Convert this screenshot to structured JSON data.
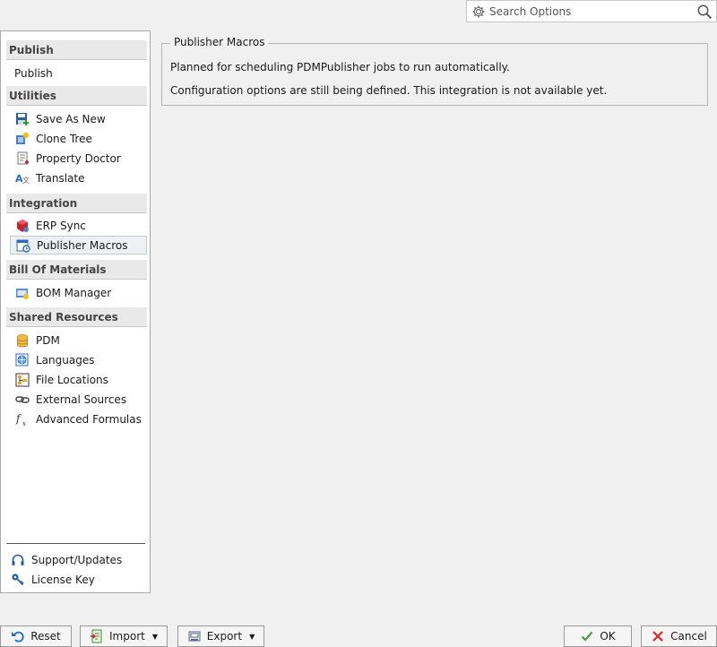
{
  "search": {
    "placeholder": "Search Options"
  },
  "sidebar": {
    "groups": [
      {
        "header": "Publish",
        "items": [
          {
            "label": "Publish",
            "icon": "none"
          }
        ]
      },
      {
        "header": "Utilities",
        "items": [
          {
            "label": "Save As New",
            "icon": "save-as-new-icon"
          },
          {
            "label": "Clone Tree",
            "icon": "clone-tree-icon"
          },
          {
            "label": "Property Doctor",
            "icon": "property-doctor-icon"
          },
          {
            "label": "Translate",
            "icon": "translate-icon"
          }
        ]
      },
      {
        "header": "Integration",
        "items": [
          {
            "label": "ERP Sync",
            "icon": "erp-sync-icon"
          },
          {
            "label": "Publisher Macros",
            "icon": "publisher-macros-icon",
            "selected": true
          }
        ]
      },
      {
        "header": "Bill Of Materials",
        "items": [
          {
            "label": "BOM Manager",
            "icon": "bom-manager-icon"
          }
        ]
      },
      {
        "header": "Shared Resources",
        "items": [
          {
            "label": "PDM",
            "icon": "database-icon"
          },
          {
            "label": "Languages",
            "icon": "globe-icon"
          },
          {
            "label": "File Locations",
            "icon": "folder-tree-icon"
          },
          {
            "label": "External Sources",
            "icon": "link-icon"
          },
          {
            "label": "Advanced Formulas",
            "icon": "function-icon"
          }
        ]
      }
    ],
    "bottom": [
      {
        "label": "Support/Updates",
        "icon": "headset-icon"
      },
      {
        "label": "License Key",
        "icon": "key-icon"
      }
    ]
  },
  "main": {
    "group_title": "Publisher Macros",
    "line1": "Planned for scheduling PDMPublisher jobs to run automatically.",
    "line2": "Configuration options are still being defined. This integration is not available yet."
  },
  "footer": {
    "reset": "Reset",
    "import": "Import",
    "export": "Export",
    "ok": "OK",
    "cancel": "Cancel"
  },
  "colors": {
    "accent_blue": "#1e6fc7",
    "cancel_red": "#d9262c",
    "ok_green": "#3a9a3a"
  }
}
